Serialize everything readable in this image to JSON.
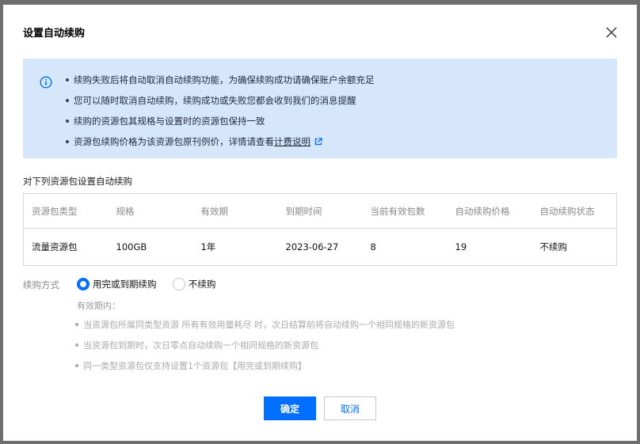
{
  "dialog": {
    "title": "设置自动续购"
  },
  "notice": {
    "items": [
      "续购失败后将自动取消自动续购功能，为确保续购成功请确保账户余额充足",
      "您可以随时取消自动续购，续购成功或失败您都会收到我们的消息提醒",
      "续购的资源包其规格与设置时的资源包保持一致"
    ],
    "last_item_prefix": "资源包续购价格为该资源包原刊例价，详情请查看",
    "link_text": "计费说明"
  },
  "section_label": "对下列资源包设置自动续购",
  "table": {
    "headers": [
      "资源包类型",
      "规格",
      "有效期",
      "到期时间",
      "当前有效包数",
      "自动续购价格",
      "自动续购状态"
    ],
    "rows": [
      [
        "流量资源包",
        "100GB",
        "1年",
        "2023-06-27",
        "8",
        "19",
        "不续购"
      ]
    ]
  },
  "renew": {
    "label": "续购方式",
    "option_on": "用完或到期续购",
    "option_off": "不续购",
    "selected": "用完或到期续购",
    "validity_title": "有效期内：",
    "rules": [
      "当资源包所属同类型资源 所有有效用量耗尽 时，次日结算前将自动续购一个相同规格的新资源包",
      "当资源包到期时，次日零点自动续购一个相同规格的新资源包",
      "同一类型资源包仅支持设置1个资源包【用完或到期续购】"
    ]
  },
  "buttons": {
    "confirm": "确定",
    "cancel": "取消"
  },
  "colors": {
    "primary": "#006eff",
    "notice_bg": "#d6e6fb"
  },
  "icons": [
    "close-icon",
    "info-icon",
    "external-link-icon"
  ]
}
